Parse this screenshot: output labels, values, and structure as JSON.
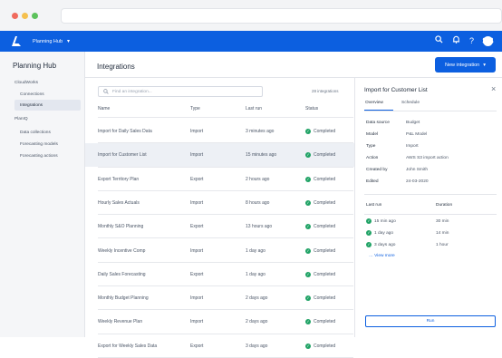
{
  "app": {
    "hub_name": "Planning Hub",
    "avatar_initials": "SB"
  },
  "sidebar": {
    "title": "Planning Hub",
    "groups": [
      {
        "label": "CloudWorks",
        "items": [
          {
            "label": "Connections"
          },
          {
            "label": "Integrations",
            "active": true
          }
        ]
      },
      {
        "label": "PlanIQ",
        "items": [
          {
            "label": "Data collections"
          },
          {
            "label": "Forecasting models"
          },
          {
            "label": "Forecasting actions"
          }
        ]
      }
    ]
  },
  "main": {
    "title": "Integrations",
    "new_button": "New integration",
    "search_placeholder": "Find an integration...",
    "count": "28 integrations",
    "columns": [
      "Name",
      "Type",
      "Last run",
      "Status"
    ],
    "rows": [
      {
        "name": "Import for Daily Sales Data",
        "type": "Import",
        "last_run": "3 minutes ago",
        "status": "Completed"
      },
      {
        "name": "Import for Customer List",
        "type": "Import",
        "last_run": "15 minutes ago",
        "status": "Completed",
        "selected": true
      },
      {
        "name": "Export Territory Plan",
        "type": "Export",
        "last_run": "2 hours ago",
        "status": "Completed"
      },
      {
        "name": "Hourly Sales Actuals",
        "type": "Import",
        "last_run": "8 hours ago",
        "status": "Completed"
      },
      {
        "name": "Monthly S&O Planning",
        "type": "Export",
        "last_run": "13 hours ago",
        "status": "Completed"
      },
      {
        "name": "Weekly Incentive Comp",
        "type": "Import",
        "last_run": "1 day ago",
        "status": "Completed"
      },
      {
        "name": "Daily Sales Forecasting",
        "type": "Export",
        "last_run": "1 day ago",
        "status": "Completed"
      },
      {
        "name": "Monthly Budget Planning",
        "type": "Import",
        "last_run": "2 days ago",
        "status": "Completed"
      },
      {
        "name": "Weekly Revenue Plan",
        "type": "Import",
        "last_run": "2 days ago",
        "status": "Completed"
      },
      {
        "name": "Export for Weekly Sales Data",
        "type": "Export",
        "last_run": "3 days ago",
        "status": "Completed"
      }
    ]
  },
  "details": {
    "title": "Import for Customer List",
    "tabs": [
      {
        "label": "Overview",
        "active": true
      },
      {
        "label": "Schedule"
      }
    ],
    "fields": [
      {
        "key": "Data source",
        "value": "Budget"
      },
      {
        "key": "Model",
        "value": "P&L Model"
      },
      {
        "key": "Type",
        "value": "Import"
      },
      {
        "key": "Action",
        "value": "AWS S3 import action"
      },
      {
        "key": "Created by",
        "value": "John Smith"
      },
      {
        "key": "Edited",
        "value": "24-03-2020"
      }
    ],
    "last_run_header": "Last run",
    "duration_header": "Duration",
    "runs": [
      {
        "when": "15 min ago",
        "duration": "30 min"
      },
      {
        "when": "1 day ago",
        "duration": "14 min"
      },
      {
        "when": "3 days ago",
        "duration": "1 hour"
      }
    ],
    "view_more": "View more",
    "run_button": "Run"
  },
  "colors": {
    "accent": "#0c5fe0",
    "success": "#21a366",
    "selected_row": "#edf0f5"
  }
}
